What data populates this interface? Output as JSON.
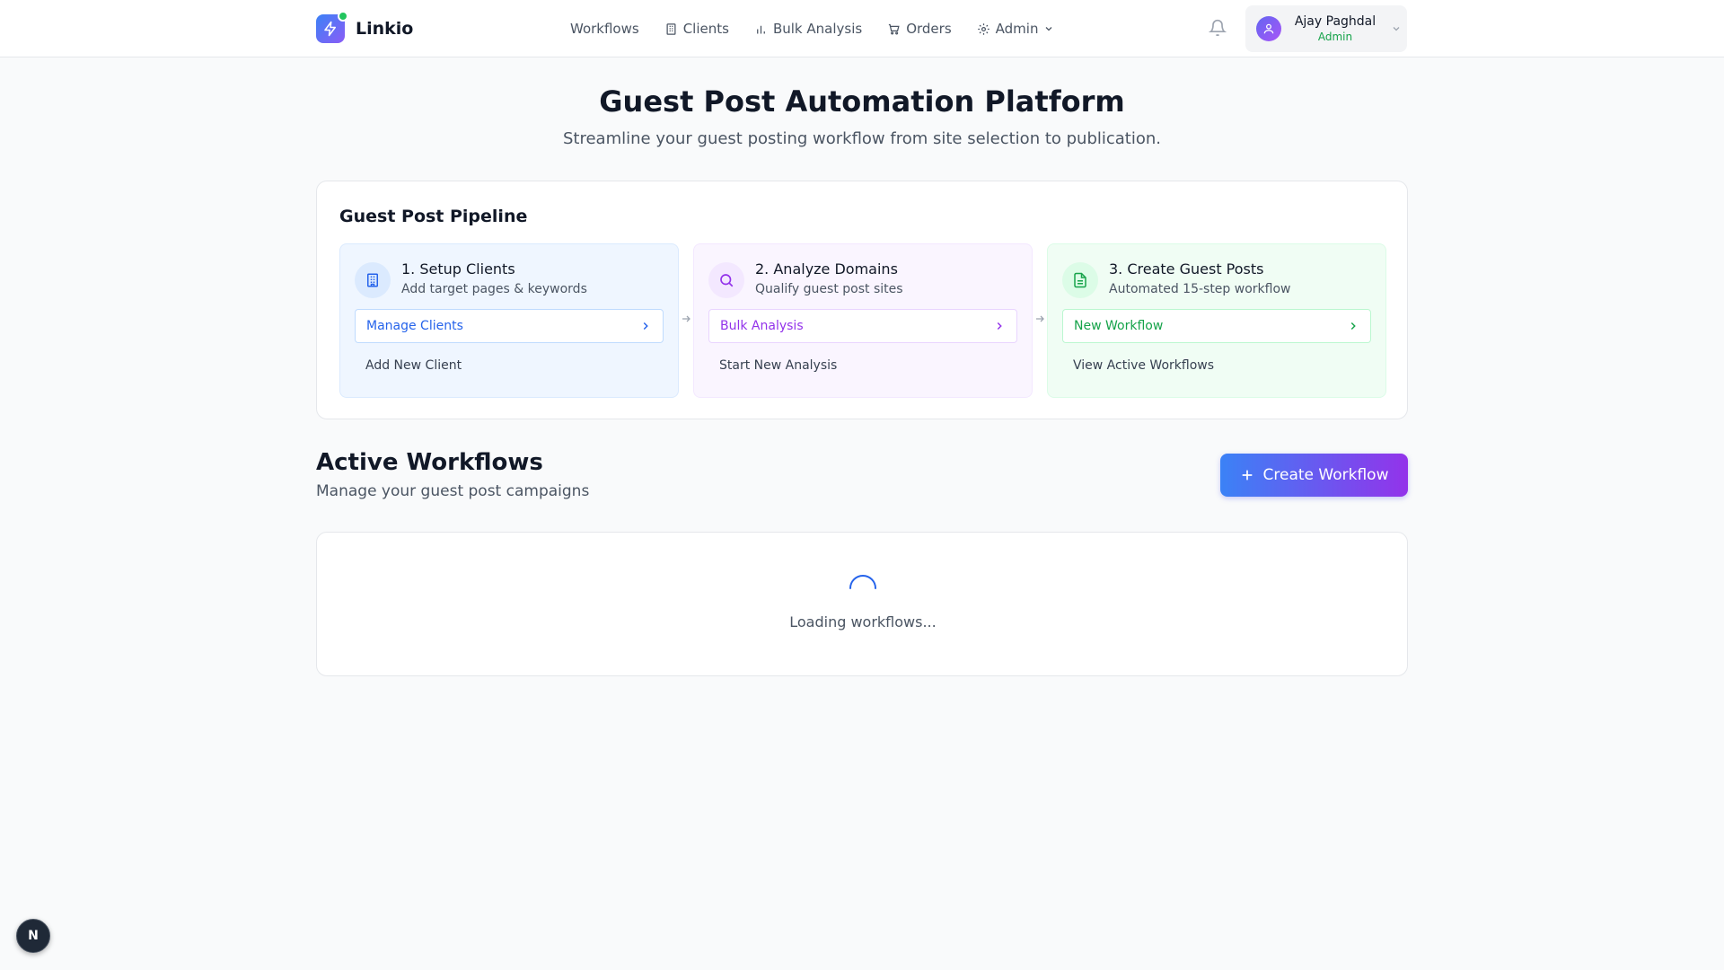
{
  "brand": {
    "name": "Linkio",
    "icon": "lightning-bolt-icon",
    "colors": {
      "gradient_start": "#3b82f6",
      "gradient_end": "#8b5cf6",
      "status_dot": "#22c55e"
    }
  },
  "nav": {
    "items": [
      {
        "label": "Workflows",
        "icon": null
      },
      {
        "label": "Clients",
        "icon": "building-icon"
      },
      {
        "label": "Bulk Analysis",
        "icon": "bar-chart-icon"
      },
      {
        "label": "Orders",
        "icon": "cart-icon"
      },
      {
        "label": "Admin",
        "icon": "gear-icon",
        "dropdown": true
      }
    ]
  },
  "user": {
    "name": "Ajay Paghdal",
    "role": "Admin",
    "role_color": "#16a34a"
  },
  "hero": {
    "title": "Guest Post Automation Platform",
    "subtitle": "Streamline your guest posting workflow from site selection to publication."
  },
  "pipeline": {
    "title": "Guest Post Pipeline",
    "stages": [
      {
        "title": "1. Setup Clients",
        "description": "Add target pages & keywords",
        "icon": "building-icon",
        "primary_action": "Manage Clients",
        "secondary_action": "Add New Client",
        "accent": "#2563eb"
      },
      {
        "title": "2. Analyze Domains",
        "description": "Qualify guest post sites",
        "icon": "search-icon",
        "primary_action": "Bulk Analysis",
        "secondary_action": "Start New Analysis",
        "accent": "#9333ea"
      },
      {
        "title": "3. Create Guest Posts",
        "description": "Automated 15-step workflow",
        "icon": "document-icon",
        "primary_action": "New Workflow",
        "secondary_action": "View Active Workflows",
        "accent": "#16a34a"
      }
    ]
  },
  "active_workflows": {
    "title": "Active Workflows",
    "subtitle": "Manage your guest post campaigns",
    "create_button": "Create Workflow",
    "loading_text": "Loading workflows..."
  },
  "dev_badge": {
    "label": "N"
  }
}
